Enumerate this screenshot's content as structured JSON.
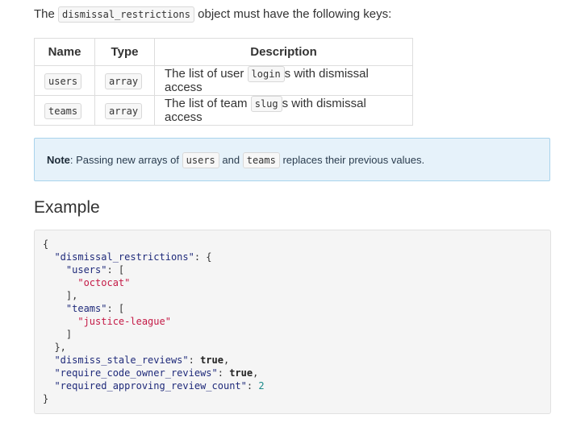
{
  "intro": {
    "prefix": "The",
    "object_name": "dismissal_restrictions",
    "suffix": "object must have the following keys:"
  },
  "table": {
    "headers": [
      "Name",
      "Type",
      "Description"
    ],
    "rows": [
      {
        "name": "users",
        "type": "array",
        "desc_prefix": "The list of user",
        "desc_code": "login",
        "desc_suffix": "s with dismissal access"
      },
      {
        "name": "teams",
        "type": "array",
        "desc_prefix": "The list of team",
        "desc_code": "slug",
        "desc_suffix": "s with dismissal access"
      }
    ]
  },
  "note": {
    "label": "Note",
    "text1": ": Passing new arrays of",
    "code1": "users",
    "text2": "and",
    "code2": "teams",
    "text3": "replaces their previous values."
  },
  "example": {
    "heading": "Example",
    "brace_open": "{",
    "brace_close": "}",
    "key_dismissal": "\"dismissal_restrictions\"",
    "key_users": "\"users\"",
    "val_user": "\"octocat\"",
    "key_teams": "\"teams\"",
    "val_team": "\"justice-league\"",
    "key_stale": "\"dismiss_stale_reviews\"",
    "val_stale": "true",
    "key_codeowner": "\"require_code_owner_reviews\"",
    "val_codeowner": "true",
    "key_count": "\"required_approving_review_count\"",
    "val_count": "2"
  }
}
